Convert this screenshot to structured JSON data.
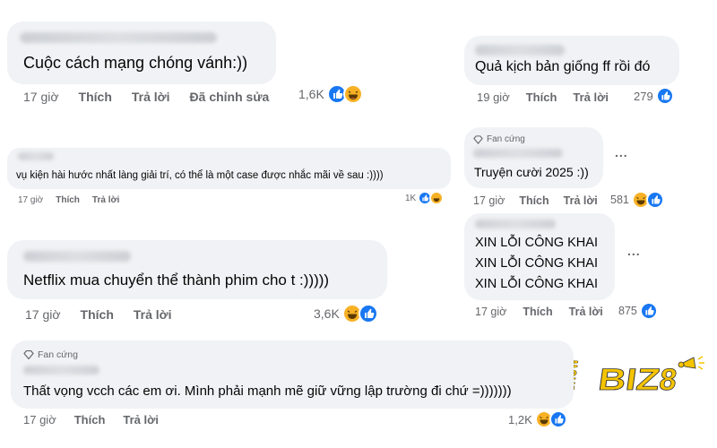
{
  "comments": [
    {
      "text": "Cuộc cách mạng chóng vánh:))",
      "time": "17 giờ",
      "like": "Thích",
      "reply": "Trả lời",
      "edited": "Đã chỉnh sửa",
      "count": "1,6K"
    },
    {
      "text": "Quả kịch bản giống ff rồi đó",
      "time": "19 giờ",
      "like": "Thích",
      "reply": "Trả lời",
      "count": "279"
    },
    {
      "text": "vụ kiện hài hước nhất làng giải trí, có thể là một case được nhắc mãi về sau :))))",
      "time": "17 giờ",
      "like": "Thích",
      "reply": "Trả lời",
      "count": "1K"
    },
    {
      "badge": "Fan cứng",
      "text": "Truyện cười 2025 :))",
      "time": "17 giờ",
      "like": "Thích",
      "reply": "Trả lời",
      "count": "581",
      "more": "..."
    },
    {
      "text": "Netflix mua chuyển thể thành phim cho t :)))))",
      "time": "17 giờ",
      "like": "Thích",
      "reply": "Trả lời",
      "count": "3,6K"
    },
    {
      "lines": [
        "XIN LỖI CÔNG KHAI",
        "XIN LỖI CÔNG KHAI",
        "XIN LỖI CÔNG KHAI"
      ],
      "time": "17 giờ",
      "like": "Thích",
      "reply": "Trả lời",
      "count": "875",
      "more": "..."
    },
    {
      "badge": "Fan cứng",
      "text": "Thất vọng vcch các em ơi. Mình phải mạnh mẽ giữ vững lập trường đi chứ =)))))))",
      "time": "17 giờ",
      "like": "Thích",
      "reply": "Trả lời",
      "count": "1,2K"
    }
  ],
  "logo": {
    "text_a": "SHOW",
    "text_b": "BIZ",
    "text_c": "8"
  },
  "colors": {
    "bubble": "#f0f2f5",
    "meta": "#65676b",
    "like": "#1877f2",
    "haha": "#f7b125",
    "logo": "#f5c400"
  }
}
